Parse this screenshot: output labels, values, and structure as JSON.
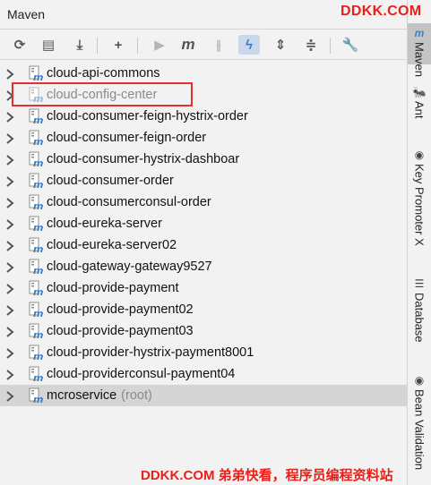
{
  "panel": {
    "title": "Maven"
  },
  "watermark": {
    "top": "DDKK.COM",
    "bottom": "DDKK.COM 弟弟快看，程序员编程资料站"
  },
  "toolbar": {
    "buttons": [
      {
        "icon": "reimport-icon",
        "glyph": "⟳"
      },
      {
        "icon": "generate-sources-icon",
        "glyph": "▤"
      },
      {
        "icon": "download-icon",
        "glyph": "⤓"
      },
      {
        "icon": "add-icon",
        "glyph": "+"
      },
      {
        "icon": "run-icon",
        "glyph": "▶"
      },
      {
        "icon": "execute-goal-icon",
        "glyph": "m"
      },
      {
        "icon": "skip-tests-icon",
        "glyph": "⫲"
      },
      {
        "icon": "offline-mode-icon",
        "glyph": "ϟ"
      },
      {
        "icon": "expand-all-icon",
        "glyph": "⇕"
      },
      {
        "icon": "collapse-all-icon",
        "glyph": "≑"
      },
      {
        "icon": "settings-wrench-icon",
        "glyph": "🔧"
      }
    ]
  },
  "projects": [
    {
      "name": "cloud-api-commons",
      "greyed": false
    },
    {
      "name": "cloud-config-center",
      "greyed": true
    },
    {
      "name": "cloud-consumer-feign-hystrix-order",
      "greyed": false
    },
    {
      "name": "cloud-consumer-feign-order",
      "greyed": false
    },
    {
      "name": "cloud-consumer-hystrix-dashboar",
      "greyed": false
    },
    {
      "name": "cloud-consumer-order",
      "greyed": false
    },
    {
      "name": "cloud-consumerconsul-order",
      "greyed": false
    },
    {
      "name": "cloud-eureka-server",
      "greyed": false
    },
    {
      "name": "cloud-eureka-server02",
      "greyed": false
    },
    {
      "name": "cloud-gateway-gateway9527",
      "greyed": false
    },
    {
      "name": "cloud-provide-payment",
      "greyed": false
    },
    {
      "name": "cloud-provide-payment02",
      "greyed": false
    },
    {
      "name": "cloud-provide-payment03",
      "greyed": false
    },
    {
      "name": "cloud-provider-hystrix-payment8001",
      "greyed": false
    },
    {
      "name": "cloud-providerconsul-payment04",
      "greyed": false
    },
    {
      "name": "mcroservice",
      "suffix": "(root)",
      "greyed": false,
      "selected": true
    }
  ],
  "side_tabs": [
    {
      "label": "Maven",
      "icon": "maven-icon",
      "glyph": "m",
      "active": true
    },
    {
      "label": "Ant",
      "icon": "ant-icon",
      "glyph": "🐜",
      "active": false
    },
    {
      "label": "Key Promoter X",
      "icon": "key-promoter-icon",
      "glyph": "◉",
      "active": false
    },
    {
      "label": "Database",
      "icon": "database-icon",
      "glyph": "☰",
      "active": false
    },
    {
      "label": "Bean Validation",
      "icon": "bean-validation-icon",
      "glyph": "◉",
      "active": false
    }
  ]
}
